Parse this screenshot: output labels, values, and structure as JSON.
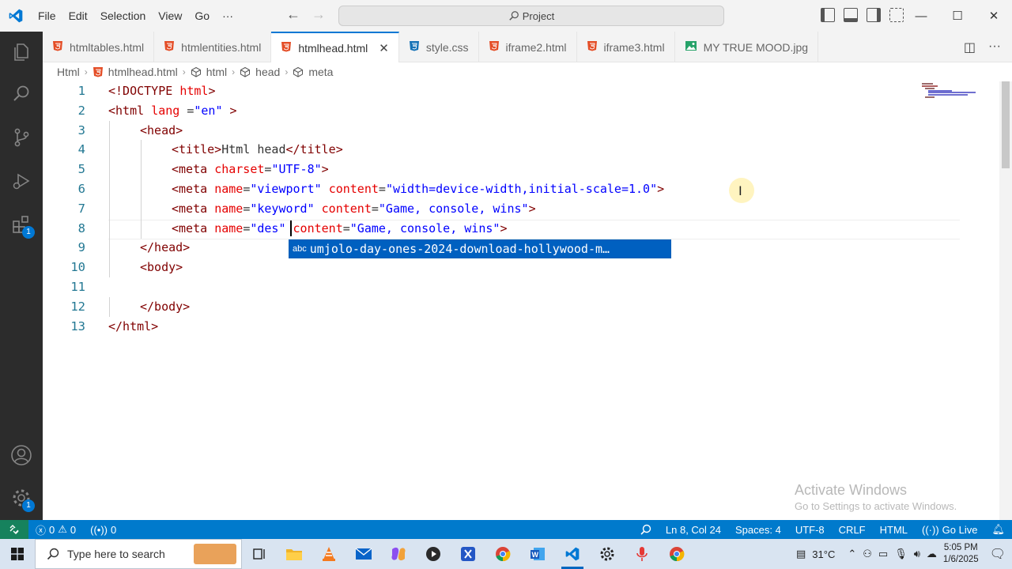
{
  "menu": [
    "File",
    "Edit",
    "Selection",
    "View",
    "Go",
    "···"
  ],
  "command_center": "Project",
  "tabs": [
    {
      "label": "htmltables.html",
      "icon": "html5-icon",
      "active": false
    },
    {
      "label": "htmlentities.html",
      "icon": "html5-icon",
      "active": false
    },
    {
      "label": "htmlhead.html",
      "icon": "html5-icon",
      "active": true
    },
    {
      "label": "style.css",
      "icon": "css3-icon",
      "active": false
    },
    {
      "label": "iframe2.html",
      "icon": "html5-icon",
      "active": false
    },
    {
      "label": "iframe3.html",
      "icon": "html5-icon",
      "active": false
    },
    {
      "label": "MY TRUE MOOD.jpg",
      "icon": "image-icon",
      "active": false
    }
  ],
  "breadcrumb": [
    "Html",
    "htmlhead.html",
    "html",
    "head",
    "meta"
  ],
  "editor": {
    "lines": [
      {
        "n": "1",
        "indent": 0,
        "tokens": [
          [
            "t",
            "<!DOCTYPE "
          ],
          [
            "a",
            "html"
          ],
          [
            "t",
            ">"
          ]
        ]
      },
      {
        "n": "2",
        "indent": 0,
        "tokens": [
          [
            "t",
            "<html "
          ],
          [
            "a",
            "lang "
          ],
          [
            "p",
            "="
          ],
          [
            "s",
            "\"en\""
          ],
          [
            "t",
            " >"
          ]
        ]
      },
      {
        "n": "3",
        "indent": 1,
        "tokens": [
          [
            "t",
            "<head>"
          ]
        ]
      },
      {
        "n": "4",
        "indent": 2,
        "tokens": [
          [
            "t",
            "<title>"
          ],
          [
            "p",
            "Html head"
          ],
          [
            "t",
            "</title>"
          ]
        ]
      },
      {
        "n": "5",
        "indent": 2,
        "tokens": [
          [
            "t",
            "<meta "
          ],
          [
            "a",
            "charset"
          ],
          [
            "p",
            "="
          ],
          [
            "s",
            "\"UTF-8\""
          ],
          [
            "t",
            ">"
          ]
        ]
      },
      {
        "n": "6",
        "indent": 2,
        "tokens": [
          [
            "t",
            "<meta "
          ],
          [
            "a",
            "name"
          ],
          [
            "p",
            "="
          ],
          [
            "s",
            "\"viewport\""
          ],
          [
            "p",
            " "
          ],
          [
            "a",
            "content"
          ],
          [
            "p",
            "="
          ],
          [
            "s",
            "\"width=device-width,initial-scale=1.0\""
          ],
          [
            "t",
            ">"
          ]
        ]
      },
      {
        "n": "7",
        "indent": 2,
        "tokens": [
          [
            "t",
            "<meta "
          ],
          [
            "a",
            "name"
          ],
          [
            "p",
            "="
          ],
          [
            "s",
            "\"keyword\""
          ],
          [
            "p",
            " "
          ],
          [
            "a",
            "content"
          ],
          [
            "p",
            "="
          ],
          [
            "s",
            "\"Game, console, wins\""
          ],
          [
            "t",
            ">"
          ]
        ]
      },
      {
        "n": "8",
        "indent": 2,
        "tokens": [
          [
            "t",
            "<meta "
          ],
          [
            "a",
            "name"
          ],
          [
            "p",
            "="
          ],
          [
            "s",
            "\"des\""
          ],
          [
            "p",
            " "
          ],
          [
            "a",
            "content"
          ],
          [
            "p",
            "="
          ],
          [
            "s",
            "\"Game, console, wins\""
          ],
          [
            "t",
            ">"
          ]
        ]
      },
      {
        "n": "9",
        "indent": 1,
        "tokens": [
          [
            "t",
            "</head>"
          ]
        ]
      },
      {
        "n": "10",
        "indent": 1,
        "tokens": [
          [
            "t",
            "<body>"
          ]
        ]
      },
      {
        "n": "11",
        "indent": 0,
        "tokens": []
      },
      {
        "n": "12",
        "indent": 1,
        "tokens": [
          [
            "t",
            "</body>"
          ]
        ]
      },
      {
        "n": "13",
        "indent": 0,
        "tokens": [
          [
            "t",
            "</html>"
          ]
        ]
      }
    ],
    "suggestion": {
      "kind": "abc",
      "text": "umjolo-day-ones-2024-download-hollywood-m…"
    }
  },
  "watermark": {
    "title": "Activate Windows",
    "subtitle": "Go to Settings to activate Windows."
  },
  "statusbar": {
    "errors": "0",
    "warnings": "0",
    "ports": "0",
    "cursor": "Ln 8, Col 24",
    "spaces": "Spaces: 4",
    "encoding": "UTF-8",
    "eol": "CRLF",
    "language": "HTML",
    "golive": "Go Live"
  },
  "activity_badges": {
    "extensions": "1",
    "settings": "1"
  },
  "taskbar": {
    "search_placeholder": "Type here to search",
    "temperature": "31°C",
    "time": "5:05 PM",
    "date": "1/6/2025"
  },
  "colors": {
    "accent": "#007acc",
    "tag": "#800000",
    "attr": "#e50000",
    "string": "#0000ff"
  }
}
